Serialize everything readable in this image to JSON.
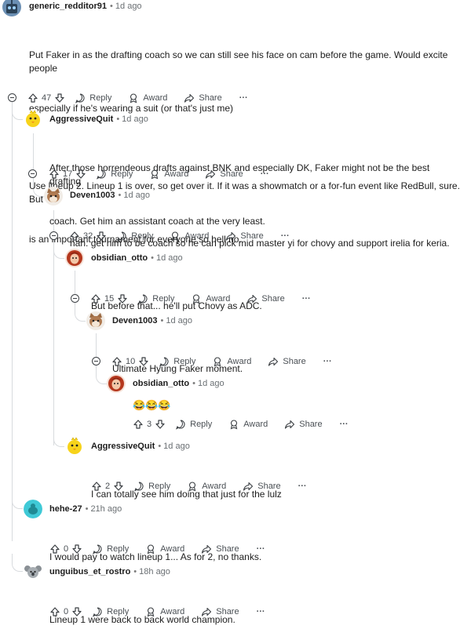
{
  "action_labels": {
    "reply": "Reply",
    "award": "Award",
    "share": "Share",
    "more": "···"
  },
  "colors": {
    "thread_line": "#d8dbde",
    "text": "#1c1c1c",
    "muted": "#6a6f73"
  },
  "comments": [
    {
      "author": "generic_redditor91",
      "time": "1d ago",
      "score": "47",
      "avatar_icon": "robot-avatar-icon",
      "body": [
        "Put Faker in as the drafting coach so we can still see his face on cam before the game. Would excite people",
        "especially if he's wearing a suit (or that's just me)",
        "Use lineup 2. Lineup 1 is over, so get over it. If it was a showmatch or a for-fun event like RedBull, sure. But t",
        "is an important tournament for everyone so hell no."
      ]
    },
    {
      "author": "AggressiveQuit",
      "time": "1d ago",
      "score": "17",
      "avatar_icon": "yellow-chick-avatar-icon",
      "body": [
        "After those horrendeous drafts against BNK and especially DK, Faker might not be the best drafting",
        "coach. Get him an assistant coach at the very least."
      ]
    },
    {
      "author": "Deven1003",
      "time": "1d ago",
      "score": "32",
      "avatar_icon": "cat-avatar-icon",
      "body": [
        "nah. get him to be coach so he can pick mid master yi for chovy and support irelia for keria."
      ]
    },
    {
      "author": "obsidian_otto",
      "time": "1d ago",
      "score": "15",
      "avatar_icon": "redhead-avatar-icon",
      "body": [
        "But before that... he'll put Chovy as ADC."
      ]
    },
    {
      "author": "Deven1003",
      "time": "1d ago",
      "score": "10",
      "avatar_icon": "cat-avatar-icon",
      "body": [
        "Ultimate Hyung Faker moment."
      ]
    },
    {
      "author": "obsidian_otto",
      "time": "1d ago",
      "score": "3",
      "avatar_icon": "redhead-avatar-icon",
      "body": [
        "😂😂😂"
      ]
    },
    {
      "author": "AggressiveQuit",
      "time": "1d ago",
      "score": "2",
      "avatar_icon": "yellow-chick-avatar-icon",
      "body": [
        "I can totally see him doing that just for the lulz"
      ]
    },
    {
      "author": "hehe-27",
      "time": "21h ago",
      "score": "0",
      "avatar_icon": "teal-snoo-avatar-icon",
      "body": [
        "I would pay to watch lineup 1... As for 2, no thanks."
      ]
    },
    {
      "author": "unguibus_et_rostro",
      "time": "18h ago",
      "score": "0",
      "avatar_icon": "grey-koala-avatar-icon",
      "body": [
        "Lineup 1 were back to back world champion."
      ]
    }
  ]
}
